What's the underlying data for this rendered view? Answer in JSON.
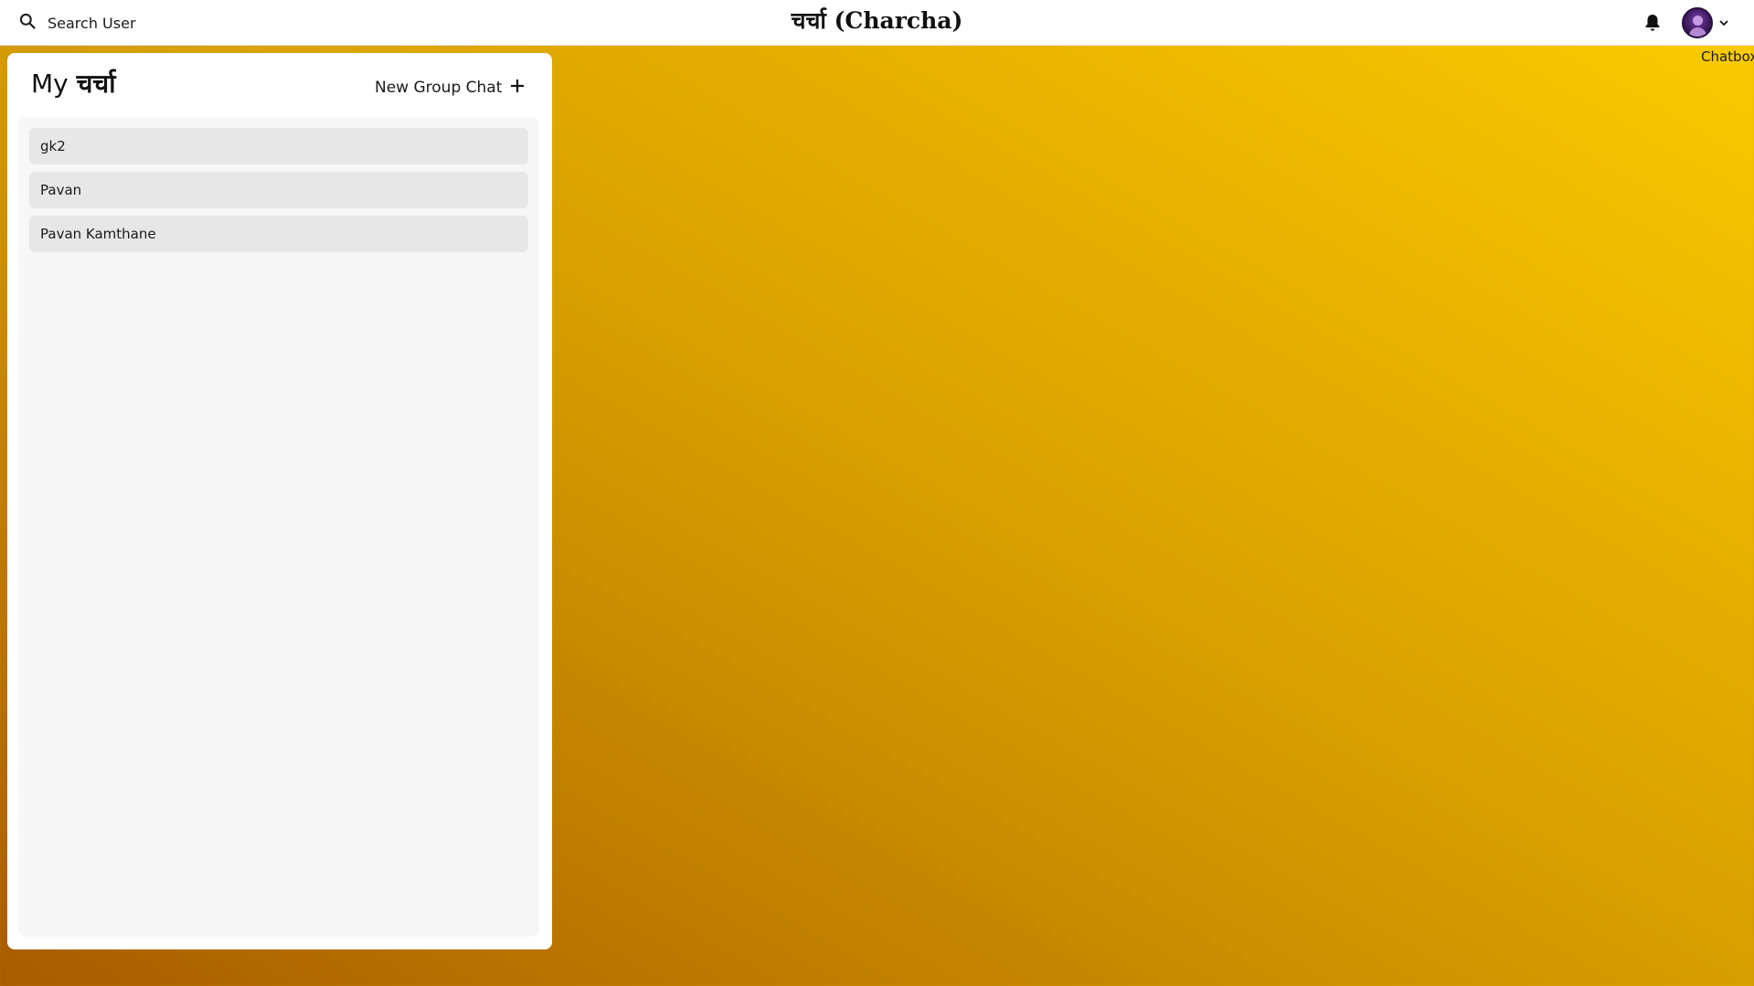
{
  "header": {
    "search_label": "Search User",
    "app_title": "चर्चा (Charcha)",
    "search_icon": "search-icon",
    "notification_icon": "bell-icon",
    "avatar_menu_icon": "chevron-down-icon"
  },
  "chatbox_label": "Chatbox",
  "sidebar": {
    "title_prefix": "My",
    "title_word": "चर्चा",
    "new_group_label": "New Group Chat",
    "new_group_icon": "plus-icon",
    "chats": [
      {
        "name": "gk2"
      },
      {
        "name": "Pavan"
      },
      {
        "name": "Pavan Kamthane"
      }
    ]
  },
  "colors": {
    "background_start": "#a85c00",
    "background_end": "#fbcd00",
    "panel": "#ffffff",
    "list_bg": "#f7f7f7",
    "item_bg": "#e7e7e7"
  }
}
